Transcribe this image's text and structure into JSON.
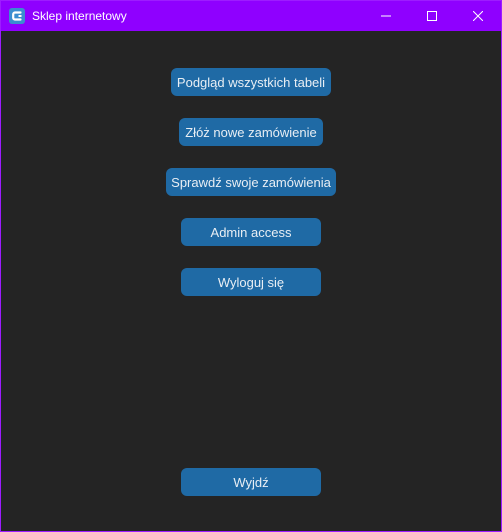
{
  "window": {
    "title": "Sklep internetowy",
    "app_icon": "customtkinter-icon",
    "controls": {
      "minimize_icon": "minimize-icon",
      "maximize_icon": "maximize-icon",
      "close_icon": "close-icon"
    }
  },
  "menu": {
    "view_all_tables": "Podgląd wszystkich tabeli",
    "new_order": "Złóż nowe zamówienie",
    "check_orders": "Sprawdź swoje zamówienia",
    "admin_access": "Admin access",
    "logout": "Wyloguj się",
    "exit": "Wyjdź"
  },
  "colors": {
    "titlebar": "#8f00ff",
    "background": "#242424",
    "button": "#1f6aa5",
    "button_text": "#e8eef4"
  }
}
